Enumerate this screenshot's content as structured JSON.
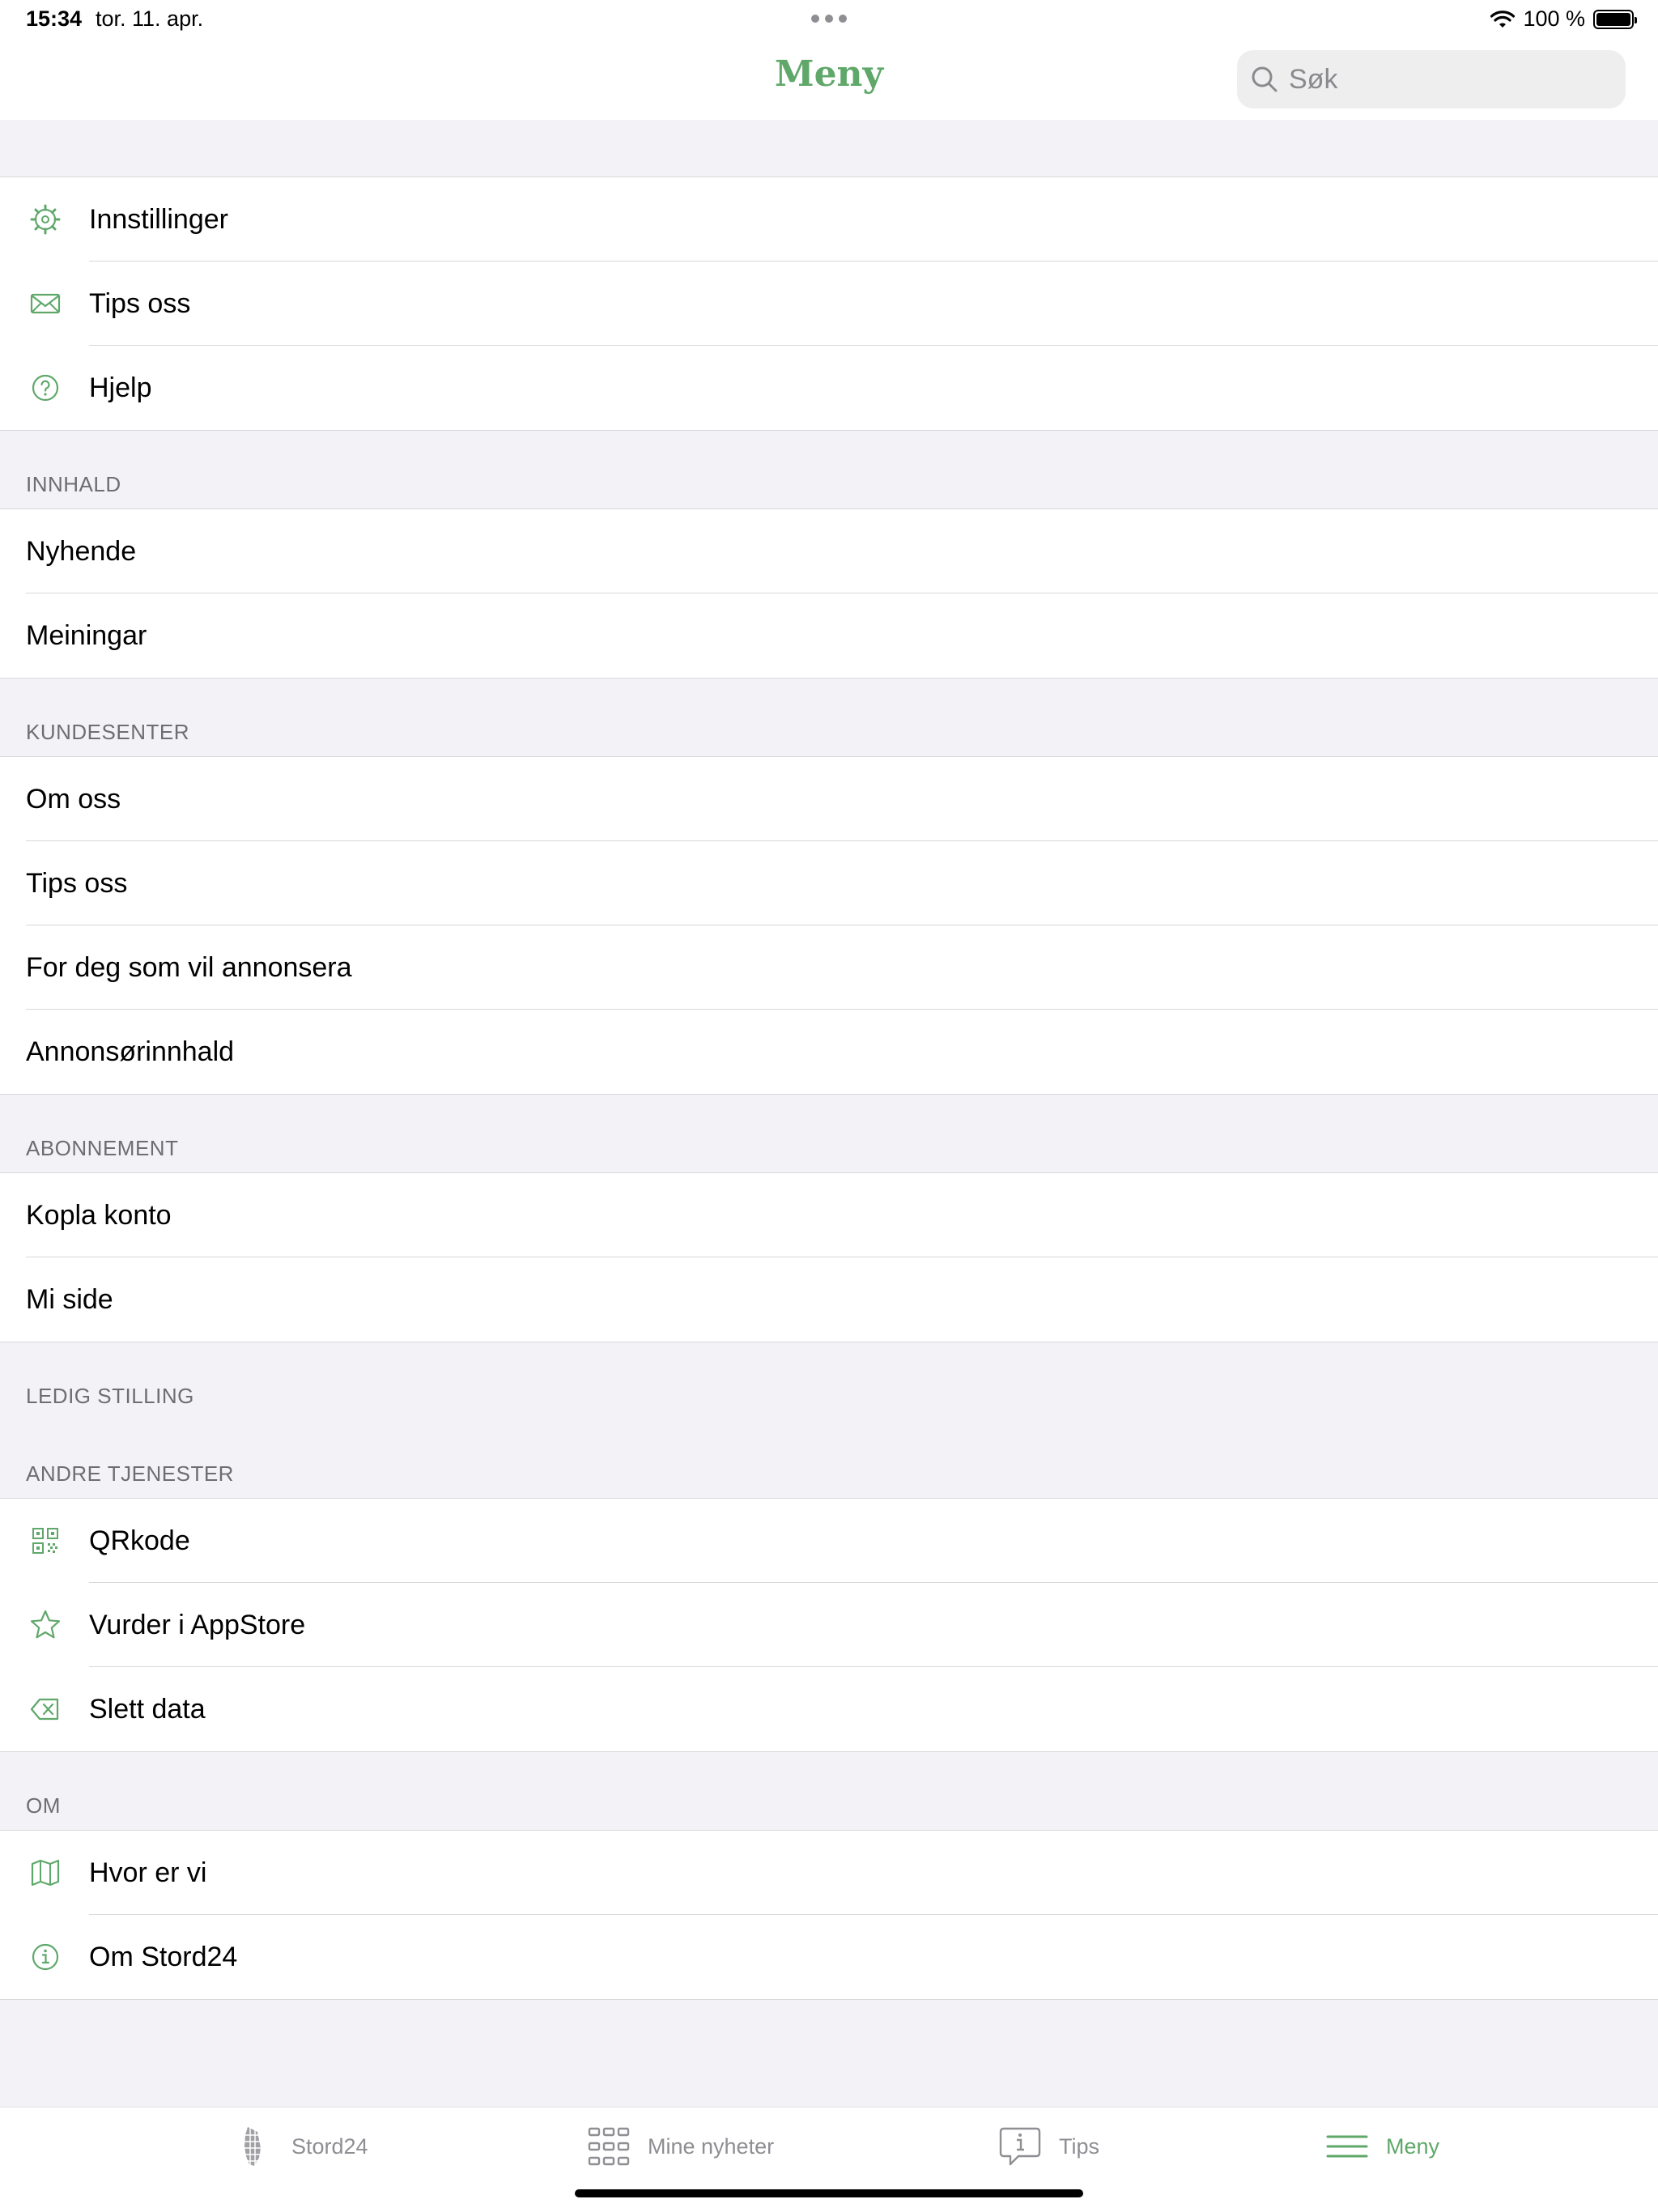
{
  "status_bar": {
    "time": "15:34",
    "date": "tor. 11. apr.",
    "battery": "100 %"
  },
  "nav": {
    "title": "Meny",
    "search_placeholder": "Søk"
  },
  "colors": {
    "accent": "#5fa86a",
    "inactive": "#8e8e93",
    "background": "#f2f2f7"
  },
  "top_items": [
    {
      "label": "Innstillinger",
      "icon": "gear-icon"
    },
    {
      "label": "Tips oss",
      "icon": "mail-icon"
    },
    {
      "label": "Hjelp",
      "icon": "help-icon"
    }
  ],
  "sections": {
    "innhald": {
      "header": "INNHALD",
      "items": [
        "Nyhende",
        "Meiningar"
      ]
    },
    "kundesenter": {
      "header": "KUNDESENTER",
      "items": [
        "Om oss",
        "Tips oss",
        "For deg som vil annonsera",
        "Annonsørinnhald"
      ]
    },
    "abonnement": {
      "header": "ABONNEMENT",
      "items": [
        "Kopla konto",
        "Mi side"
      ]
    },
    "ledig_stilling": {
      "header": "LEDIG STILLING"
    },
    "andre_tjenester": {
      "header": "ANDRE TJENESTER",
      "items": [
        {
          "label": "QRkode",
          "icon": "qr-code-icon"
        },
        {
          "label": "Vurder i AppStore",
          "icon": "star-icon"
        },
        {
          "label": "Slett data",
          "icon": "delete-icon"
        }
      ]
    },
    "om": {
      "header": "OM",
      "items": [
        {
          "label": "Hvor er vi",
          "icon": "map-icon"
        },
        {
          "label": "Om Stord24",
          "icon": "info-icon"
        }
      ]
    }
  },
  "tabs": [
    {
      "label": "Stord24",
      "icon": "stord24-logo-icon"
    },
    {
      "label": "Mine nyheter",
      "icon": "grid-icon"
    },
    {
      "label": "Tips",
      "icon": "tips-bubble-icon"
    },
    {
      "label": "Meny",
      "icon": "menu-icon",
      "active": true
    }
  ]
}
